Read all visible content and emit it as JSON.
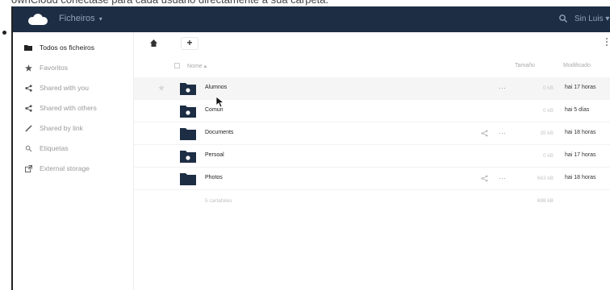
{
  "caption": "ownCloud conectase para cada usuario directamente á súa carpeta.",
  "header": {
    "app_title": "Ficheiros",
    "app_caret": "▾",
    "user_label": "Sin Luis ▾"
  },
  "sidebar": {
    "items": [
      {
        "label": "Todos os ficheiros",
        "icon": "folder-icon",
        "active": true
      },
      {
        "label": "Favoritos",
        "icon": "star-icon",
        "active": false
      },
      {
        "label": "Shared with you",
        "icon": "share-icon",
        "active": false
      },
      {
        "label": "Shared with others",
        "icon": "share-icon",
        "active": false
      },
      {
        "label": "Shared by link",
        "icon": "link-icon",
        "active": false
      },
      {
        "label": "Etiquetas",
        "icon": "tag-icon",
        "active": false
      },
      {
        "label": "External storage",
        "icon": "external-storage-icon",
        "active": false
      }
    ]
  },
  "toolbar": {
    "new_label": "+"
  },
  "table": {
    "columns": {
      "name": "Nome ▴",
      "size": "Tamaño",
      "modified": "Modificado"
    },
    "rows": [
      {
        "name": "Alumnos",
        "type": "shared-folder",
        "shared_icon": false,
        "more": "···",
        "size": "0 kB",
        "modified": "hai 17 horas",
        "hovered": true
      },
      {
        "name": "Comun",
        "type": "shared-folder",
        "shared_icon": false,
        "more": "",
        "size": "0 kB",
        "modified": "hai 5 días",
        "hovered": false
      },
      {
        "name": "Documents",
        "type": "folder",
        "shared_icon": true,
        "more": "···",
        "size": "35 kB",
        "modified": "hai 18 horas",
        "hovered": false
      },
      {
        "name": "Persoal",
        "type": "shared-folder",
        "shared_icon": false,
        "more": "",
        "size": "0 kB",
        "modified": "hai 17 horas",
        "hovered": false
      },
      {
        "name": "Photos",
        "type": "folder",
        "shared_icon": true,
        "more": "···",
        "size": "663 kB",
        "modified": "hai 18 horas",
        "hovered": false
      }
    ],
    "summary_count": "5 cartafoles",
    "summary_total": "698 kB"
  },
  "colors": {
    "header_bg": "#1d2d44",
    "folder": "#1d2d44",
    "accent_text": "#93a3b7"
  }
}
